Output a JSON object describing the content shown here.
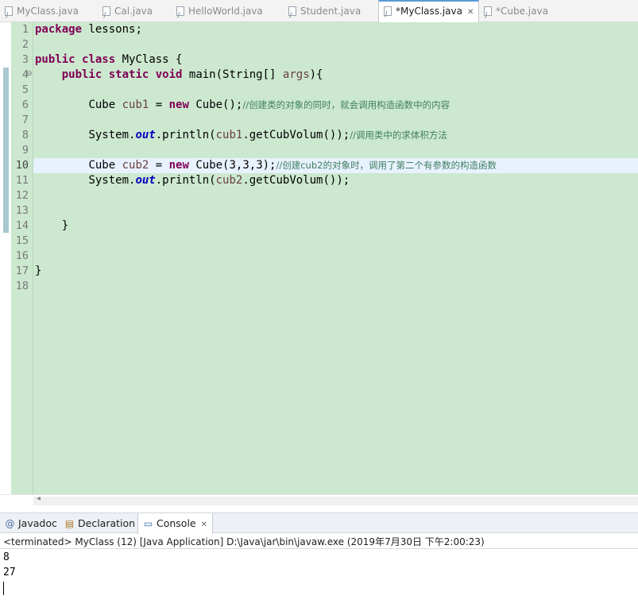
{
  "editor_tabs": [
    {
      "label": "MyClass.java"
    },
    {
      "label": "Cal.java"
    },
    {
      "label": "HelloWorld.java"
    },
    {
      "label": "Student.java"
    },
    {
      "label": "*MyClass.java"
    },
    {
      "label": "*Cube.java"
    }
  ],
  "code": {
    "line_numbers": [
      "1",
      "2",
      "3",
      "4",
      "5",
      "6",
      "7",
      "8",
      "9",
      "10",
      "11",
      "12",
      "13",
      "14",
      "15",
      "16",
      "17",
      "18"
    ],
    "l1_kw": "package",
    "l1_rest": " lessons;",
    "l3_kw1": "public",
    "l3_kw2": "class",
    "l3_rest": " MyClass {",
    "l4_kw1": "public",
    "l4_kw2": "static",
    "l4_kw3": "void",
    "l4_mid": " main(String[] ",
    "l4_var": "args",
    "l4_end": "){",
    "l6_type": "Cube ",
    "l6_var": "cub1",
    "l6_eq": " = ",
    "l6_kw": "new",
    "l6_call": " Cube();",
    "l6_comment": "//创建类的对象的同时，就会调用构造函数中的内容",
    "l8_pre": "System.",
    "l8_field": "out",
    "l8_mid": ".println(",
    "l8_var": "cub1",
    "l8_end": ".getCubVolum());",
    "l8_comment": "//调用类中的求体积方法",
    "l10_type": "Cube ",
    "l10_var": "cub2",
    "l10_eq": " = ",
    "l10_kw": "new",
    "l10_call": " Cube(3,3,3);",
    "l10_comment": "//创建cub2的对象时，调用了第二个有参数的构造函数",
    "l11_pre": "System.",
    "l11_field": "out",
    "l11_mid": ".println(",
    "l11_var": "cub2",
    "l11_end": ".getCubVolum());",
    "l14_text": "}",
    "l17_text": "}"
  },
  "bottom_panel": {
    "tabs": [
      {
        "label": "Javadoc",
        "icon": "at-icon"
      },
      {
        "label": "Declaration",
        "icon": "declaration-icon"
      },
      {
        "label": "Console",
        "icon": "console-icon"
      }
    ],
    "status": "<terminated> MyClass (12) [Java Application] D:\\Java\\jar\\bin\\javaw.exe (2019年7月30日 下午2:00:23)",
    "output": [
      "8",
      "27"
    ]
  }
}
